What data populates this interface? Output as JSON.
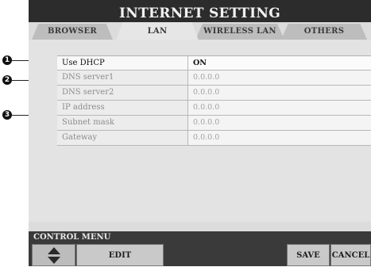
{
  "window": {
    "title": "INTERNET SETTING"
  },
  "tabs": [
    {
      "label": "BROWSER",
      "active": false
    },
    {
      "label": "LAN",
      "active": true
    },
    {
      "label": "WIRELESS LAN",
      "active": false
    },
    {
      "label": "OTHERS",
      "active": false
    }
  ],
  "settings": [
    {
      "label": "Use DHCP",
      "value": "ON"
    },
    {
      "label": "DNS server1",
      "value": "0.0.0.0"
    },
    {
      "label": "DNS server2",
      "value": "0.0.0.0"
    },
    {
      "label": "IP address",
      "value": "0.0.0.0"
    },
    {
      "label": "Subnet mask",
      "value": "0.0.0.0"
    },
    {
      "label": "Gateway",
      "value": "0.0.0.0"
    }
  ],
  "callouts": [
    "1",
    "2",
    "3"
  ],
  "control_menu": {
    "label": "CONTROL MENU",
    "edit": "EDIT",
    "save": "SAVE",
    "cancel": "CANCEL"
  },
  "icons": {
    "up": "up-arrow-icon",
    "down": "down-arrow-icon"
  }
}
